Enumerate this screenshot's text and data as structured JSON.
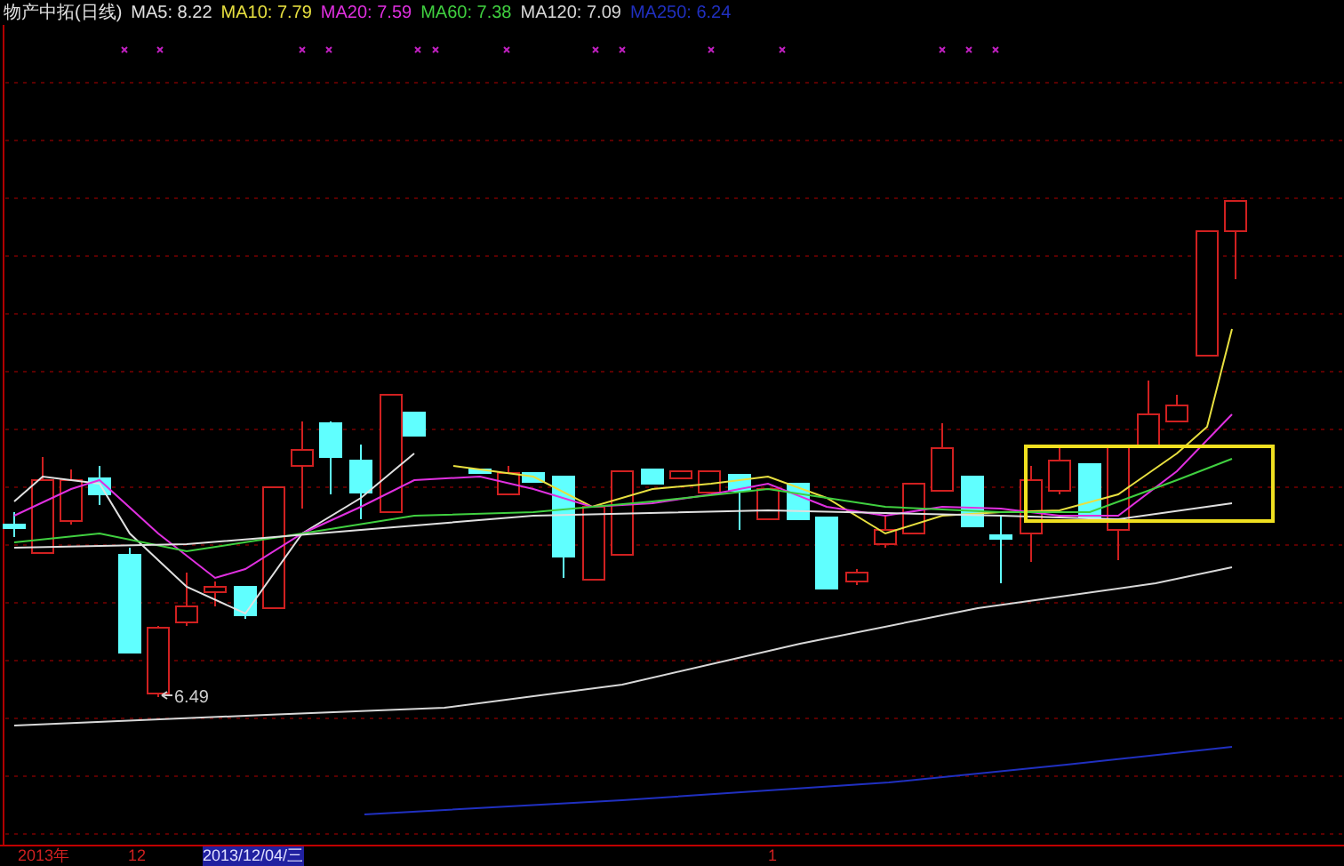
{
  "legend": {
    "title": "物产中拓(日线)",
    "items": [
      {
        "label": "MA5:",
        "value": "8.22",
        "color": "#e0e0e0"
      },
      {
        "label": "MA10:",
        "value": "7.79",
        "color": "#e8e040"
      },
      {
        "label": "MA20:",
        "value": "7.59",
        "color": "#e030e0"
      },
      {
        "label": "MA60:",
        "value": "7.38",
        "color": "#40d040"
      },
      {
        "label": "MA120:",
        "value": "7.09",
        "color": "#d8d8d8"
      },
      {
        "label": "MA250:",
        "value": "6.24",
        "color": "#2030c0"
      }
    ]
  },
  "chart": {
    "low_label": "6.49"
  },
  "axis": {
    "labels": [
      {
        "text": "2013年",
        "kind": "tick"
      },
      {
        "text": "12",
        "kind": "tick"
      },
      {
        "text": "2013/12/04/三",
        "kind": "cursor"
      },
      {
        "text": "1",
        "kind": "tick"
      }
    ]
  }
}
